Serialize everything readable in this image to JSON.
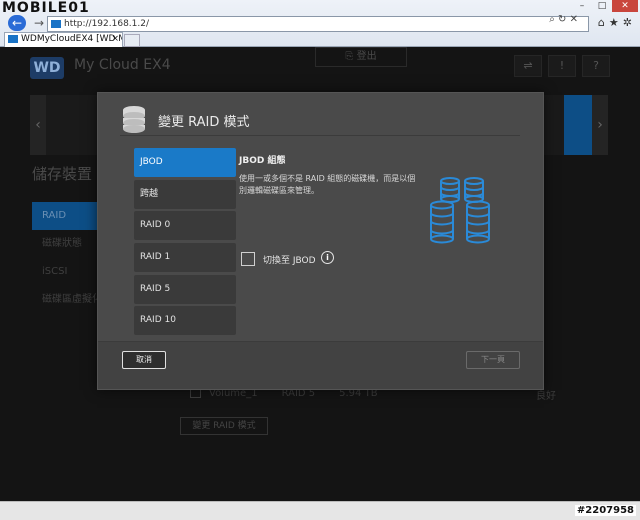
{
  "browser": {
    "brand_logo": "MOBILE01",
    "address_url": "http://192.168.1.2/",
    "tab_title": "WDMyCloudEX4 [WD My...",
    "tab_close_label": "×",
    "window_controls": {
      "minimize": "–",
      "maximize": "□",
      "close": "✕"
    },
    "toolbar_icons": [
      "home-icon",
      "star-icon",
      "gear-icon"
    ]
  },
  "wd": {
    "logo": "WD",
    "title": "My Cloud EX4",
    "exit_label": "登出",
    "section_title": "儲存裝置",
    "sidebar": [
      {
        "label": "RAID",
        "active": true
      },
      {
        "label": "磁碟狀態",
        "active": false
      },
      {
        "label": "iSCSI",
        "active": false
      },
      {
        "label": "磁碟區虛擬化",
        "active": false
      }
    ],
    "volume_row": {
      "name": "Volume_1",
      "raid": "RAID 5",
      "size": "5.94 TB",
      "status": "良好"
    },
    "change_raid_button": "變更 RAID 模式",
    "header_icons": [
      "usb-icon",
      "alert-icon",
      "help-icon"
    ]
  },
  "modal": {
    "title": "變更 RAID 模式",
    "options": [
      {
        "label": "JBOD",
        "selected": true
      },
      {
        "label": "跨越",
        "selected": false
      },
      {
        "label": "RAID 0",
        "selected": false
      },
      {
        "label": "RAID 1",
        "selected": false
      },
      {
        "label": "RAID 5",
        "selected": false
      },
      {
        "label": "RAID 10",
        "selected": false
      }
    ],
    "detail_title": "JBOD 組態",
    "detail_desc": "使用一或多個不是 RAID 組態的磁碟機，而是以個別邏輯磁碟區來管理。",
    "checkbox_label": "切換至 JBOD",
    "checkbox_checked": false,
    "cancel_label": "取消",
    "next_label": "下一頁"
  },
  "watermark": "#2207958",
  "colors": {
    "accent": "#1a7ac8",
    "modal_bg": "#4a4a4a",
    "page_bg": "#141414"
  }
}
